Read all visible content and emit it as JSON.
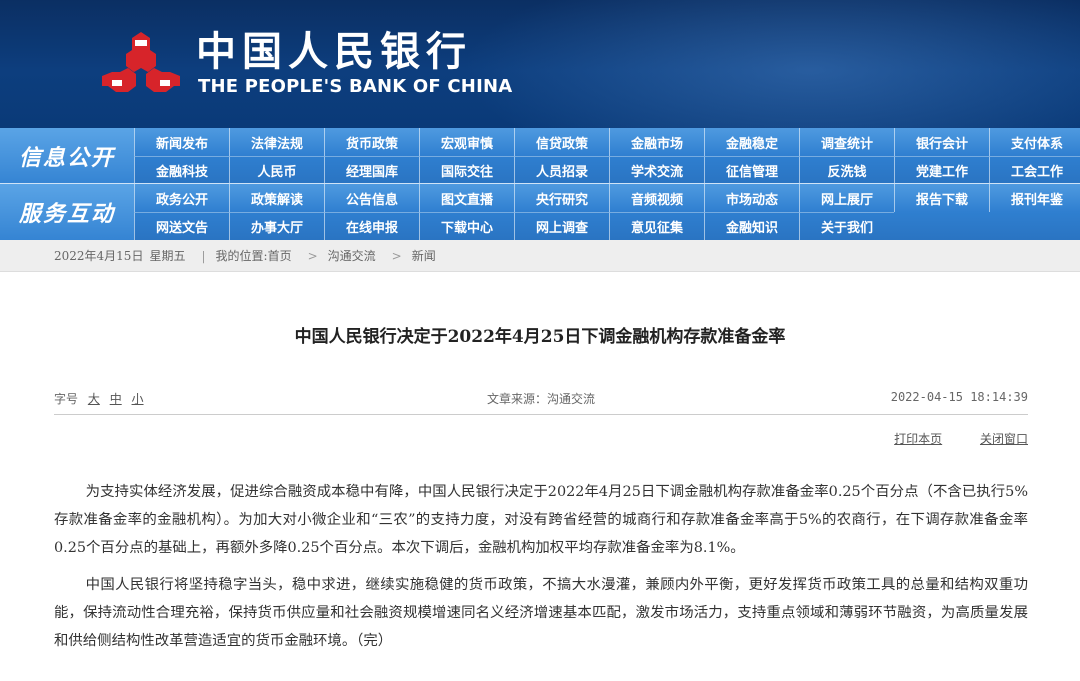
{
  "header": {
    "bank_name_cn": "中国人民银行",
    "bank_name_en": "THE PEOPLE'S BANK OF CHINA",
    "logo": "pboc-logo-icon",
    "colors": {
      "banner": "#0d3e7e",
      "logo_red": "#d7242a",
      "nav": "#3584d3"
    }
  },
  "nav_info": {
    "title": "信息公开",
    "items": [
      "新闻发布",
      "法律法规",
      "货币政策",
      "宏观审慎",
      "信贷政策",
      "金融市场",
      "金融稳定",
      "调查统计",
      "银行会计",
      "支付体系",
      "金融科技",
      "人民币",
      "经理国库",
      "国际交往",
      "人员招录",
      "学术交流",
      "征信管理",
      "反洗钱",
      "党建工作",
      "工会工作"
    ]
  },
  "nav_service": {
    "title": "服务互动",
    "items": [
      "政务公开",
      "政策解读",
      "公告信息",
      "图文直播",
      "央行研究",
      "音频视频",
      "市场动态",
      "网上展厅",
      "报告下载",
      "报刊年鉴",
      "网送文告",
      "办事大厅",
      "在线申报",
      "下载中心",
      "网上调查",
      "意见征集",
      "金融知识",
      "关于我们"
    ]
  },
  "breadcrumb": {
    "date": "2022年4月15日",
    "weekday": "星期五",
    "location_label": "我的位置:",
    "home": "首页",
    "section": "沟通交流",
    "current": "新闻",
    "sep": ">"
  },
  "article": {
    "title": "中国人民银行决定于2022年4月25日下调金融机构存款准备金率",
    "font_size_label": "字号",
    "font_sizes": [
      "大",
      "中",
      "小"
    ],
    "source": "文章来源：沟通交流",
    "datetime": "2022-04-15 18:14:39",
    "print_label": "打印本页",
    "close_label": "关闭窗口",
    "paragraphs": [
      "为支持实体经济发展，促进综合融资成本稳中有降，中国人民银行决定于2022年4月25日下调金融机构存款准备金率0.25个百分点（不含已执行5%存款准备金率的金融机构）。为加大对小微企业和“三农”的支持力度，对没有跨省经营的城商行和存款准备金率高于5%的农商行，在下调存款准备金率0.25个百分点的基础上，再额外多降0.25个百分点。本次下调后，金融机构加权平均存款准备金率为8.1%。",
      "中国人民银行将坚持稳字当头，稳中求进，继续实施稳健的货币政策，不搞大水漫灌，兼顾内外平衡，更好发挥货币政策工具的总量和结构双重功能，保持流动性合理充裕，保持货币供应量和社会融资规模增速同名义经济增速基本匹配，激发市场活力，支持重点领域和薄弱环节融资，为高质量发展和供给侧结构性改革营造适宜的货币金融环境。（完）"
    ]
  }
}
